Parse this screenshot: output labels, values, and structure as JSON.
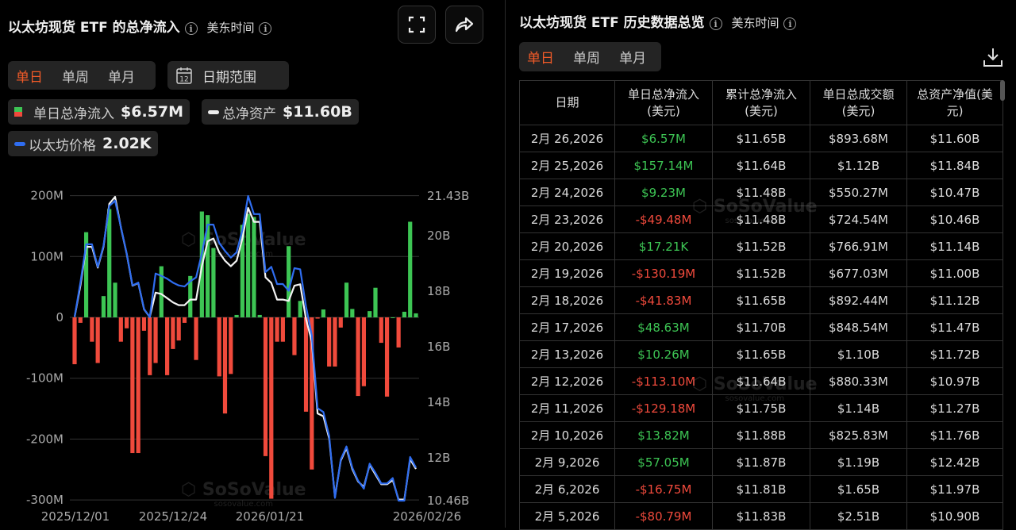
{
  "left": {
    "title": "以太坊现货 ETF 的总净流入",
    "timezone": "美东时间",
    "fullscreen_icon": "fullscreen-icon",
    "share_icon": "share-icon",
    "tabs": [
      "单日",
      "单周",
      "单月"
    ],
    "active_tab": 0,
    "date_range_label": "日期范围",
    "calendar_icon_text": "12",
    "legend": [
      {
        "label": "单日总净流入",
        "value": "$6.57M"
      },
      {
        "label": "总净资产",
        "value": "$11.60B"
      },
      {
        "label": "以太坊价格",
        "value": "2.02K"
      }
    ],
    "watermark": "SoSoValue",
    "watermark_url": "sosovalue.com"
  },
  "chart_data": {
    "type": "bar+line",
    "x_tick_labels": [
      "2025/12/01",
      "2025/12/24",
      "2026/01/21",
      "2026/02/26"
    ],
    "left_axis": {
      "ticks": [
        "200M",
        "100M",
        "0",
        "-100M",
        "-200M",
        "-300M"
      ],
      "range_millions": [
        -300,
        200
      ]
    },
    "right_axis": {
      "ticks": [
        "21.43B",
        "20B",
        "18B",
        "16B",
        "14B",
        "12B",
        "10.46B"
      ],
      "range_billions": [
        10.46,
        21.43
      ]
    },
    "colors": {
      "positive": "#3dc554",
      "negative": "#f04a3c",
      "assets": "#f2f2f2",
      "price": "#2f6df0"
    },
    "series": [
      {
        "name": "单日总净流入",
        "unit": "M USD",
        "axis": "left",
        "values": [
          -77,
          -9,
          140,
          -40,
          -75,
          35,
          178,
          57,
          -40,
          -18,
          -223,
          -223,
          -22,
          -95,
          -75,
          84,
          -95,
          -52,
          -38,
          -9,
          68,
          -70,
          174,
          168,
          114,
          -97,
          -158,
          -93,
          4,
          152,
          170,
          165,
          4,
          -228,
          -298,
          -40,
          -40,
          117,
          -62,
          27,
          -155,
          -250,
          -2,
          13,
          -80.79,
          -80.79,
          -16.75,
          57.05,
          13.82,
          -129.18,
          -113.1,
          10.26,
          48.63,
          -41.83,
          -130.19,
          0.017,
          -49.48,
          9.23,
          157.14,
          6.57
        ]
      },
      {
        "name": "总净资产",
        "unit": "B USD",
        "axis": "right",
        "values": [
          17.07,
          18.2,
          19.6,
          19.6,
          18.85,
          19.6,
          21.15,
          21.4,
          20.3,
          19.35,
          18.2,
          18.3,
          17.35,
          17.07,
          17.95,
          17.9,
          17.75,
          17.6,
          17.5,
          17.5,
          17.7,
          17.7,
          18.9,
          19.8,
          19.9,
          19.4,
          19.1,
          18.9,
          19.1,
          19.9,
          21.0,
          20.5,
          20.5,
          18.5,
          18.3,
          17.7,
          17.7,
          17.65,
          18.2,
          18.25,
          17.0,
          16.2,
          13.6,
          13.5,
          12.7,
          10.6,
          11.9,
          12.35,
          11.6,
          11.15,
          10.95,
          11.75,
          11.4,
          11.05,
          11.05,
          11.2,
          10.5,
          10.5,
          11.95,
          11.6
        ]
      },
      {
        "name": "以太坊价格",
        "unit": "scaled to right axis",
        "axis": "right",
        "values": [
          17.07,
          18.31,
          19.69,
          19.69,
          18.88,
          19.64,
          21.07,
          21.26,
          20.31,
          19.36,
          18.21,
          18.31,
          17.36,
          17.07,
          18.64,
          18.55,
          18.45,
          18.31,
          18.21,
          18.17,
          18.36,
          18.5,
          19.36,
          20.4,
          20.4,
          19.74,
          19.45,
          19.21,
          19.4,
          20.21,
          21.43,
          20.78,
          20.78,
          18.69,
          18.88,
          18.26,
          18.26,
          18.02,
          18.83,
          18.79,
          17.45,
          16.41,
          13.79,
          13.65,
          12.79,
          10.56,
          11.94,
          12.41,
          11.65,
          11.18,
          10.89,
          11.79,
          11.46,
          11.08,
          11.08,
          11.27,
          10.46,
          10.46,
          12.03,
          11.65
        ]
      }
    ]
  },
  "right": {
    "title": "以太坊现货 ETF 历史数据总览",
    "timezone": "美东时间",
    "tabs": [
      "单日",
      "单周",
      "单月"
    ],
    "active_tab": 0,
    "download_icon": "download-icon",
    "columns": [
      "日期",
      "单日总净流入\n(美元)",
      "累计总净流入\n(美元)",
      "单日总成交额\n(美元)",
      "总资产净值(美\n元)"
    ],
    "rows": [
      [
        "2月 26,2026",
        "$6.57M",
        "$11.65B",
        "$893.68M",
        "$11.60B"
      ],
      [
        "2月 25,2026",
        "$157.14M",
        "$11.64B",
        "$1.12B",
        "$11.84B"
      ],
      [
        "2月 24,2026",
        "$9.23M",
        "$11.48B",
        "$550.27M",
        "$10.47B"
      ],
      [
        "2月 23,2026",
        "-$49.48M",
        "$11.48B",
        "$724.54M",
        "$10.46B"
      ],
      [
        "2月 20,2026",
        "$17.21K",
        "$11.52B",
        "$766.91M",
        "$11.14B"
      ],
      [
        "2月 19,2026",
        "-$130.19M",
        "$11.52B",
        "$677.03M",
        "$11.00B"
      ],
      [
        "2月 18,2026",
        "-$41.83M",
        "$11.65B",
        "$892.44M",
        "$11.12B"
      ],
      [
        "2月 17,2026",
        "$48.63M",
        "$11.70B",
        "$848.54M",
        "$11.47B"
      ],
      [
        "2月 13,2026",
        "$10.26M",
        "$11.65B",
        "$1.10B",
        "$11.72B"
      ],
      [
        "2月 12,2026",
        "-$113.10M",
        "$11.64B",
        "$880.33M",
        "$10.97B"
      ],
      [
        "2月 11,2026",
        "-$129.18M",
        "$11.75B",
        "$1.14B",
        "$11.27B"
      ],
      [
        "2月 10,2026",
        "$13.82M",
        "$11.88B",
        "$825.83M",
        "$11.76B"
      ],
      [
        "2月 9,2026",
        "$57.05M",
        "$11.87B",
        "$1.19B",
        "$12.42B"
      ],
      [
        "2月 6,2026",
        "-$16.75M",
        "$11.81B",
        "$1.65B",
        "$11.97B"
      ],
      [
        "2月 5,2026",
        "-$80.79M",
        "$11.83B",
        "$2.51B",
        "$10.90B"
      ]
    ],
    "watermark": "SoSoValue",
    "watermark_url": "sosovalue.com"
  }
}
